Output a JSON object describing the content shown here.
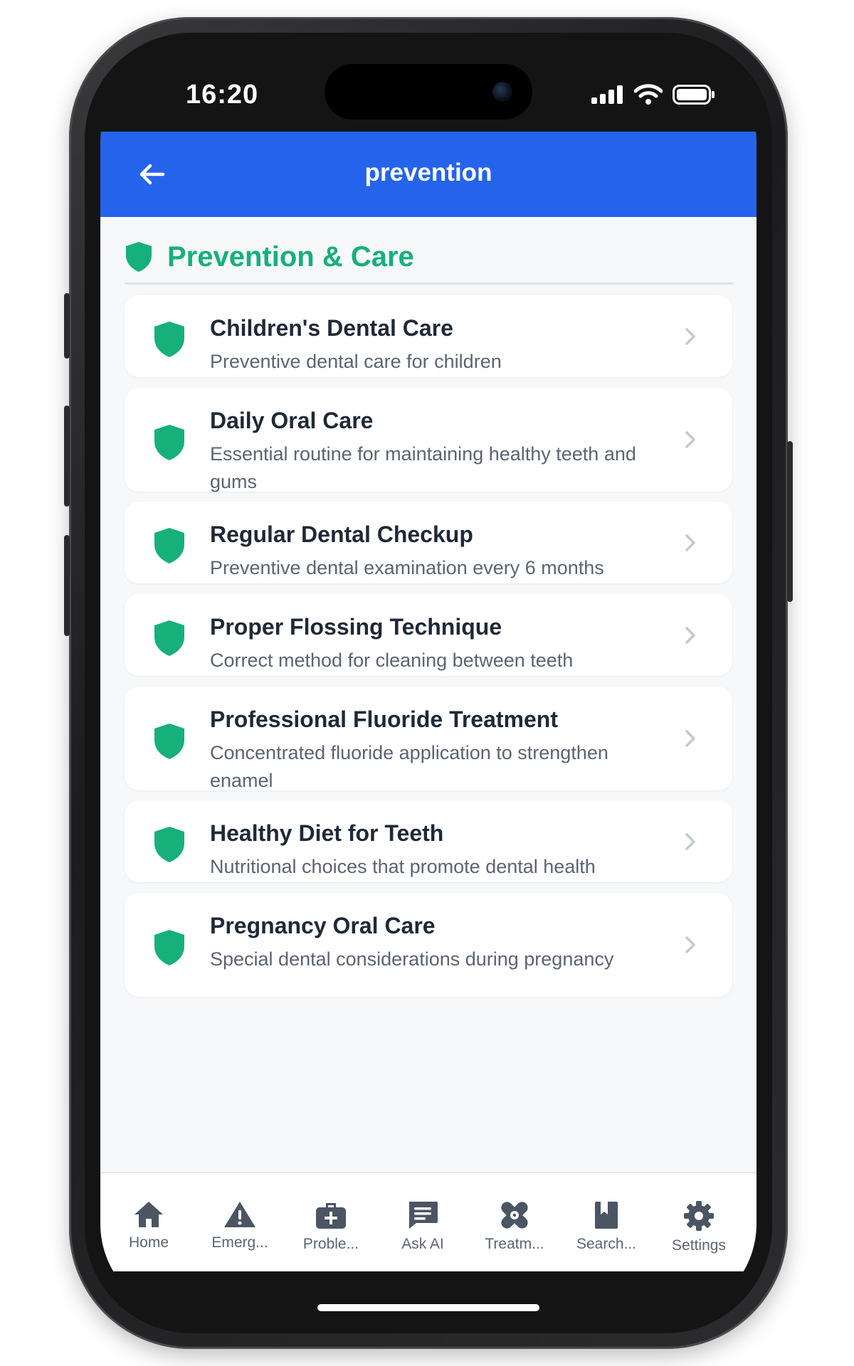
{
  "status_bar": {
    "time": "16:20"
  },
  "app_bar": {
    "title": "prevention"
  },
  "section": {
    "title": "Prevention & Care"
  },
  "items": [
    {
      "title": "Children's Dental Care",
      "description": "Preventive dental care for children"
    },
    {
      "title": "Daily Oral Care",
      "description": "Essential routine for maintaining healthy teeth and gums"
    },
    {
      "title": "Regular Dental Checkup",
      "description": "Preventive dental examination every 6 months"
    },
    {
      "title": "Proper Flossing Technique",
      "description": "Correct method for cleaning between teeth"
    },
    {
      "title": "Professional Fluoride Treatment",
      "description": "Concentrated fluoride application to strengthen enamel"
    },
    {
      "title": "Healthy Diet for Teeth",
      "description": "Nutritional choices that promote dental health"
    },
    {
      "title": "Pregnancy Oral Care",
      "description": "Special dental considerations during pregnancy"
    }
  ],
  "tabs": [
    {
      "label": "Home",
      "icon": "home-icon"
    },
    {
      "label": "Emerg...",
      "icon": "warning-icon"
    },
    {
      "label": "Proble...",
      "icon": "medkit-icon"
    },
    {
      "label": "Ask AI",
      "icon": "chat-icon"
    },
    {
      "label": "Treatm...",
      "icon": "bandage-icon"
    },
    {
      "label": "Search...",
      "icon": "book-icon"
    },
    {
      "label": "Settings",
      "icon": "gear-icon"
    }
  ],
  "colors": {
    "appbar": "#2563eb",
    "accent": "#16b07a",
    "title_text": "#1f2937",
    "secondary_text": "#5b6472"
  }
}
